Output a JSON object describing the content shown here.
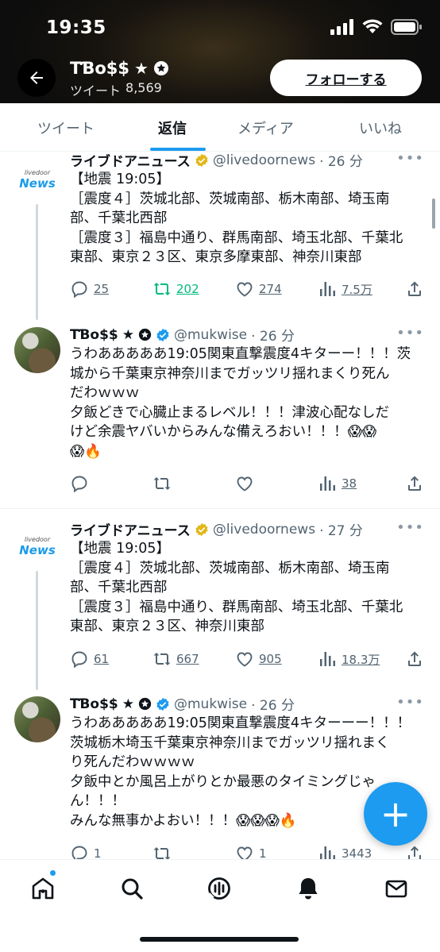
{
  "status_bar": {
    "time": "19:35"
  },
  "header": {
    "name": "TƁo$$",
    "tweet_count_label": "ツイート",
    "tweet_count": "8,569",
    "follow_label": "フォローする"
  },
  "tabs": [
    {
      "label": "ツイート",
      "active": false
    },
    {
      "label": "返信",
      "active": true
    },
    {
      "label": "メディア",
      "active": false
    },
    {
      "label": "いいね",
      "active": false
    }
  ],
  "tweets": [
    {
      "avatar": {
        "small": "livedoor",
        "big": "News"
      },
      "name": "ライブドアニュース",
      "handle": "@livedoornews",
      "time": "· 26 分",
      "lines": [
        "【地震 19:05】",
        "［震度４］茨城北部、茨城南部、栃木南部、埼玉南",
        "部、千葉北西部",
        "［震度３］福島中通り、群馬南部、埼玉北部、千葉北",
        "東部、東京２３区、東京多摩東部、神奈川東部"
      ],
      "replies": "25",
      "retweets": "202",
      "likes": "274",
      "views": "7.5万"
    },
    {
      "name": "TƁo$$",
      "handle": "@mukwise",
      "time": "· 26 分",
      "lines": [
        "うわあああああ19:05関東直撃震度4キターー！！！茨",
        "城から千葉東京神奈川までガッツリ揺れまくり死ん",
        "だわｗｗｗ",
        "夕飯どきで心臓止まるレベル！！！津波心配なしだ",
        "けど余震ヤバいからみんな備えろおい！！！😱😱",
        "😱🔥"
      ],
      "replies": "",
      "retweets": "",
      "likes": "",
      "views": "38"
    },
    {
      "avatar": {
        "small": "livedoor",
        "big": "News"
      },
      "name": "ライブドアニュース",
      "handle": "@livedoornews",
      "time": "· 27 分",
      "lines": [
        "【地震 19:05】",
        "［震度４］茨城北部、茨城南部、栃木南部、埼玉南",
        "部、千葉北西部",
        "［震度３］福島中通り、群馬南部、埼玉北部、千葉北",
        "東部、東京２３区、神奈川東部"
      ],
      "replies": "61",
      "retweets": "667",
      "likes": "905",
      "views": "18.3万"
    },
    {
      "name": "TƁo$$",
      "handle": "@mukwise",
      "time": "· 26 分",
      "lines": [
        "うわあああああ19:05関東直撃震度4キターーー！！！",
        "茨城栃木埼玉千葉東京神奈川までガッツリ揺れまく",
        "り死んだわｗｗｗｗ",
        "夕飯中とか風呂上がりとか最悪のタイミングじゃ",
        "ん！！！",
        "みんな無事かよおい！！！😱😱😱🔥"
      ],
      "replies": "1",
      "retweets": "",
      "likes": "1",
      "views": "3443"
    }
  ],
  "colors": {
    "accent": "#1d9bf0",
    "retweet_active": "#00ba7c",
    "verified_gold": "#e2b719"
  },
  "bottom_nav": [
    "home-icon",
    "search-icon",
    "spaces-icon",
    "notifications-icon",
    "messages-icon"
  ],
  "fab_label": "+"
}
